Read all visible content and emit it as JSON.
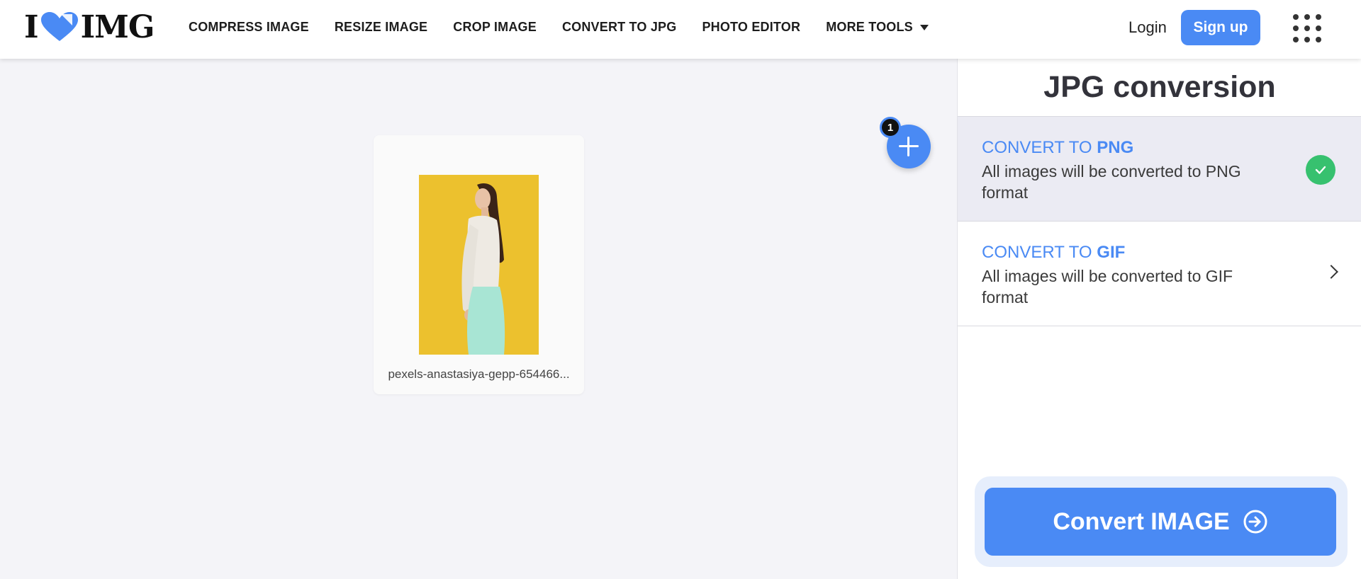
{
  "header": {
    "logo": {
      "left": "I",
      "right": "IMG"
    },
    "nav": [
      {
        "label": "COMPRESS IMAGE"
      },
      {
        "label": "RESIZE IMAGE"
      },
      {
        "label": "CROP IMAGE"
      },
      {
        "label": "CONVERT TO JPG"
      },
      {
        "label": "PHOTO EDITOR"
      },
      {
        "label": "MORE TOOLS"
      }
    ],
    "login_label": "Login",
    "signup_label": "Sign up"
  },
  "workspace": {
    "file": {
      "name": "pexels-anastasiya-gepp-654466..."
    },
    "file_count": "1"
  },
  "sidebar": {
    "title": "JPG conversion",
    "options": [
      {
        "prefix": "CONVERT TO ",
        "format": "PNG",
        "description": "All images will be converted to PNG format",
        "selected": true
      },
      {
        "prefix": "CONVERT TO ",
        "format": "GIF",
        "description": "All images will be converted to GIF format",
        "selected": false
      }
    ],
    "convert_label": "Convert IMAGE"
  },
  "colors": {
    "accent": "#4a8af4",
    "success": "#37c16f",
    "thumb_background": "#ecc12e"
  }
}
